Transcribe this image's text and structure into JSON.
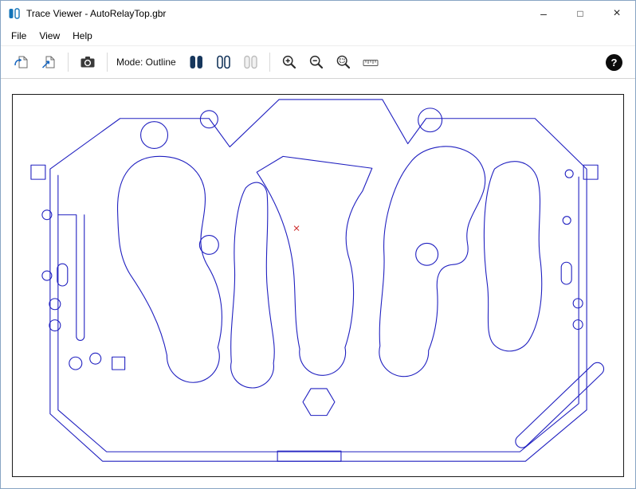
{
  "window": {
    "title": "Trace Viewer - AutoRelayTop.gbr",
    "controls": {
      "minimize": "–",
      "maximize": "□",
      "close": "×"
    }
  },
  "menu": {
    "items": [
      {
        "label": "File"
      },
      {
        "label": "View"
      },
      {
        "label": "Help"
      }
    ]
  },
  "toolbar": {
    "mode_label": "Mode: Outline",
    "help_label": "?",
    "icons": [
      "open-file",
      "convert-file",
      "snapshot-camera",
      "mode-bars-filled",
      "mode-bars-outline",
      "mode-bars-disabled",
      "zoom-in",
      "zoom-out",
      "zoom-to-region",
      "measure-ruler",
      "help"
    ]
  },
  "canvas": {
    "colors": {
      "trace": "#2020c0",
      "marker": "#cc2222",
      "border": "#1a1a1a",
      "background": "#ffffff"
    }
  }
}
